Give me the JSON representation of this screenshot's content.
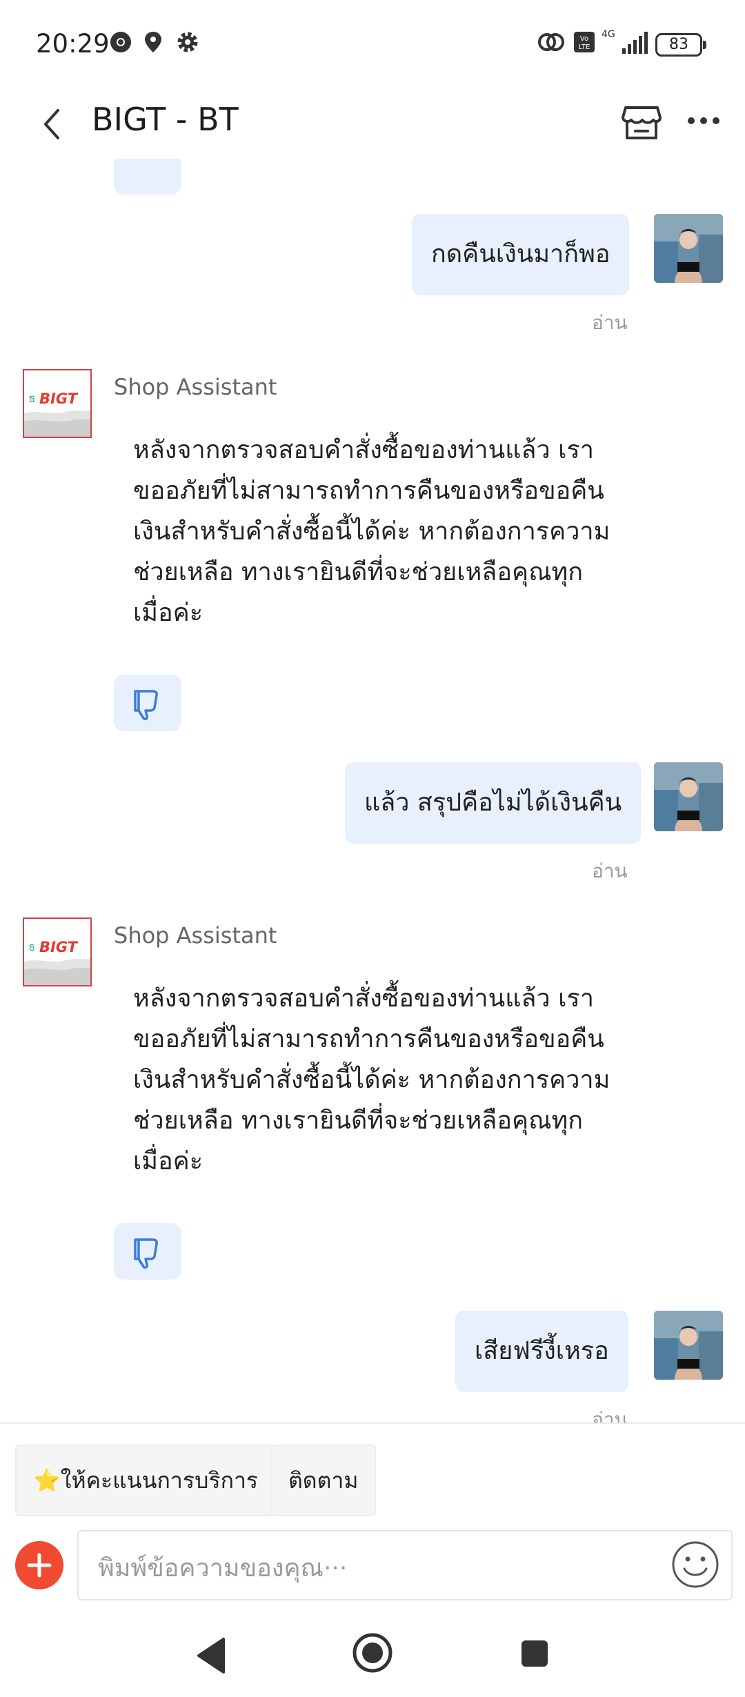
{
  "status_bar": {
    "time": "20:29",
    "battery": "83",
    "network": "4G"
  },
  "header": {
    "title": "BIGT - BT"
  },
  "shop": {
    "logo_text": "BIGT",
    "logo_prefix": "ธ"
  },
  "messages": [
    {
      "type": "out",
      "text": "กดคืนเงินมาก็พอ",
      "status": "อ่าน"
    },
    {
      "type": "in",
      "sender": "Shop Assistant",
      "lines": [
        "หลังจากตรวจสอบคำสั่งซื้อของท่านแล้ว เรา",
        "ขออภัยที่ไม่สามารถทำการคืนของหรือขอคืน",
        "เงินสำหรับคำสั่งซื้อนี้ได้ค่ะ หากต้องการความ",
        "ช่วยเหลือ ทางเรายินดีที่จะช่วยเหลือคุณทุก",
        "เมื่อค่ะ"
      ]
    },
    {
      "type": "out",
      "text": "แล้ว สรุปคือไม่ได้เงินคืน",
      "status": "อ่าน"
    },
    {
      "type": "in",
      "sender": "Shop Assistant",
      "lines": [
        "หลังจากตรวจสอบคำสั่งซื้อของท่านแล้ว เรา",
        "ขออภัยที่ไม่สามารถทำการคืนของหรือขอคืน",
        "เงินสำหรับคำสั่งซื้อนี้ได้ค่ะ หากต้องการความ",
        "ช่วยเหลือ ทางเรายินดีที่จะช่วยเหลือคุณทุก",
        "เมื่อค่ะ"
      ]
    },
    {
      "type": "out",
      "text": "เสียฟรีงี้เหรอ",
      "status": "อ่าน"
    }
  ],
  "quick_actions": {
    "rate_service": "⭐ให้คะแนนการบริการ",
    "follow": "ติดตาม"
  },
  "composer": {
    "placeholder": "พิมพ์ข้อความของคุณ···"
  },
  "colors": {
    "bubble": "#e8f0fe",
    "accent": "#f04a32",
    "thumb_icon": "#3d7bd9"
  }
}
